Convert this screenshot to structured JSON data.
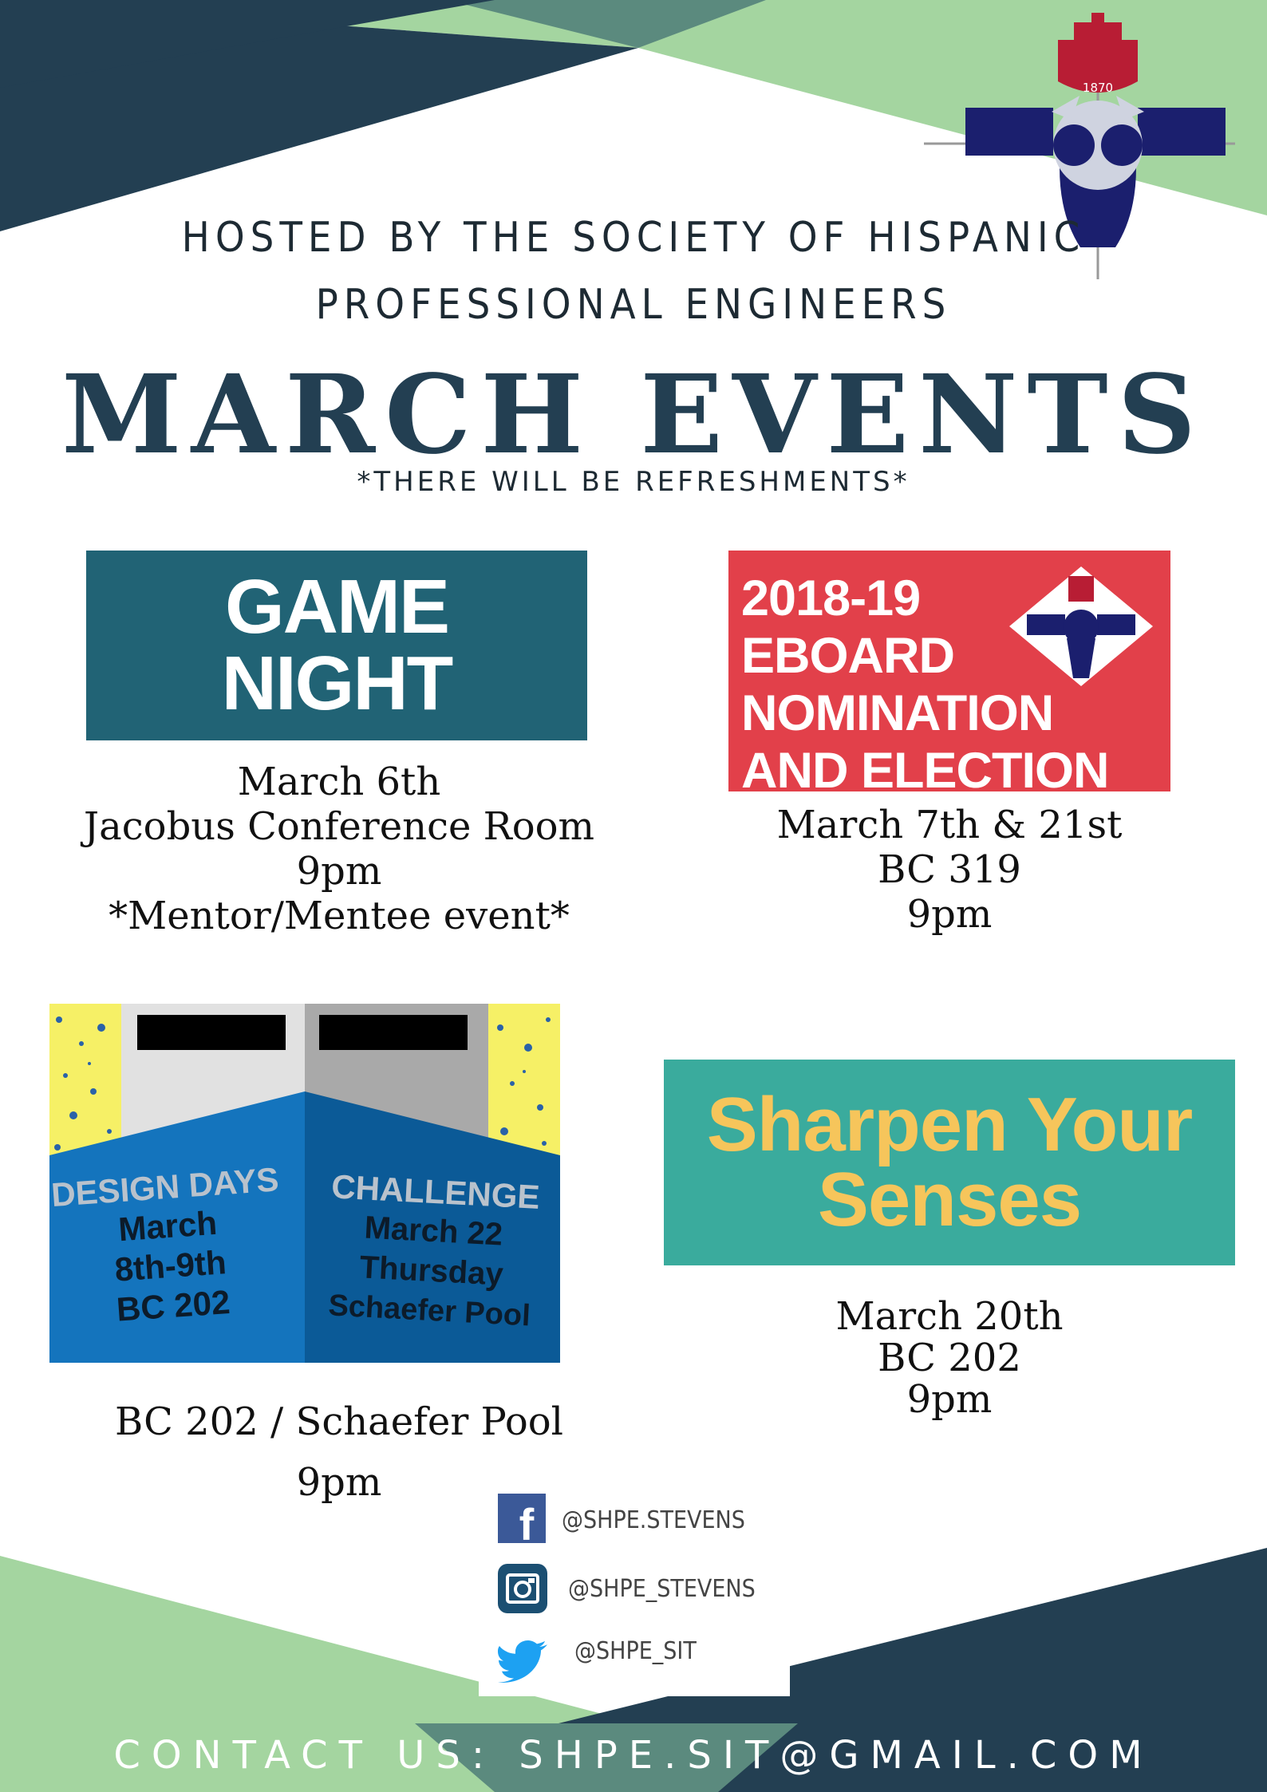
{
  "header": {
    "hosted_line1": "HOSTED BY THE SOCIETY OF HISPANIC",
    "hosted_line2": "PROFESSIONAL ENGINEERS",
    "title": "MARCH EVENTS",
    "note": "*THERE WILL BE REFRESHMENTS*",
    "seal_year": "1870"
  },
  "events": {
    "game_night": {
      "banner_line1": "GAME",
      "banner_line2": "NIGHT",
      "date": "March 6th",
      "location": "Jacobus Conference Room",
      "time": "9pm",
      "note": "*Mentor/Mentee event*"
    },
    "eboard": {
      "banner_lines": [
        "2018-19",
        "EBOARD",
        "NOMINATION",
        "AND ELECTION"
      ],
      "date": "March 7th & 21st",
      "location": "BC 319",
      "time": "9pm"
    },
    "design_days": {
      "left_title": "DESIGN DAYS",
      "left_lines": [
        "March",
        "8th-9th",
        "BC 202"
      ],
      "right_title": "CHALLENGE",
      "right_lines": [
        "March 22",
        "Thursday",
        "Schaefer Pool"
      ],
      "location": "BC 202 / Schaefer Pool",
      "time": "9pm"
    },
    "sharpen": {
      "banner_line1": "Sharpen Your",
      "banner_line2": "Senses",
      "date": "March 20th",
      "location": "BC 202",
      "time": "9pm"
    }
  },
  "social": {
    "facebook": "@SHPE.STEVENS",
    "instagram": "@SHPE_STEVENS",
    "twitter": "@SHPE_SIT"
  },
  "footer": {
    "contact": "CONTACT US: SHPE.SIT@GMAIL.COM"
  },
  "colors": {
    "navy": "#233f52",
    "green": "#a4d5a0",
    "teal": "#216375",
    "red": "#e2404a",
    "aqua": "#3aab9d",
    "gold": "#f6c55b",
    "seal_blue": "#1b1f6e",
    "seal_red": "#b81d34"
  }
}
